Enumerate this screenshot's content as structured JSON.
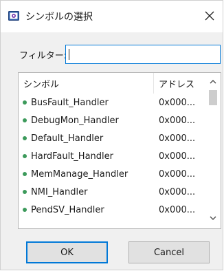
{
  "window": {
    "title": "シンボルの選択",
    "icon": "symbol-app-icon",
    "close_icon": "close-icon"
  },
  "filter": {
    "label": "フィルター:",
    "value": "",
    "placeholder": ""
  },
  "table": {
    "columns": [
      "シンボル",
      "アドレス"
    ],
    "rows": [
      {
        "symbol": "BusFault_Handler",
        "address": "0x000..."
      },
      {
        "symbol": "DebugMon_Handler",
        "address": "0x000..."
      },
      {
        "symbol": "Default_Handler",
        "address": "0x000..."
      },
      {
        "symbol": "HardFault_Handler",
        "address": "0x000..."
      },
      {
        "symbol": "MemManage_Handler",
        "address": "0x000..."
      },
      {
        "symbol": "NMI_Handler",
        "address": "0x000..."
      },
      {
        "symbol": "PendSV_Handler",
        "address": "0x000..."
      }
    ],
    "row_icon": "green-dot-icon",
    "row_icon_color": "#3c9a5b"
  },
  "buttons": {
    "ok": "OK",
    "cancel": "Cancel"
  },
  "colors": {
    "accent": "#0078d7",
    "dialog_bg": "#f0f0f0"
  }
}
